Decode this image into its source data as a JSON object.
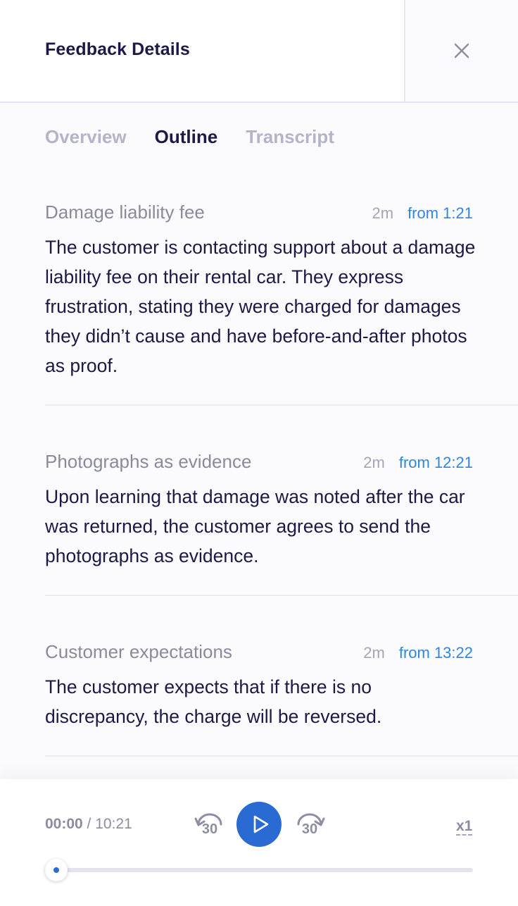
{
  "header": {
    "title": "Feedback Details"
  },
  "tabs": [
    {
      "label": "Overview",
      "active": false
    },
    {
      "label": "Outline",
      "active": true
    },
    {
      "label": "Transcript",
      "active": false
    }
  ],
  "sections": [
    {
      "title": "Damage liability fee",
      "duration": "2m",
      "from": "from 1:21",
      "body": "The customer is contacting support about a damage liability fee on their rental car. They express frustration, stating they were charged for damages they didn’t cause and have before-and-after photos as proof."
    },
    {
      "title": "Photographs as evidence",
      "duration": "2m",
      "from": "from 12:21",
      "body": "Upon learning that damage was noted after the car was returned, the customer agrees to send the photographs as evidence."
    },
    {
      "title": "Customer expectations",
      "duration": "2m",
      "from": "from 13:22",
      "body": "The customer expects that if there is no discrepancy, the charge will be reversed."
    }
  ],
  "player": {
    "current_time": "00:00",
    "separator": " / ",
    "total_time": "10:21",
    "skip_back": "30",
    "skip_forward": "30",
    "speed": "x1",
    "progress": 0.026
  },
  "colors": {
    "accent": "#2a6bd3",
    "link": "#2f86e0",
    "text": "#1d1846",
    "muted": "#8b8a9d"
  },
  "icons": {
    "close": "close-icon",
    "play": "play-icon",
    "rewind": "rewind-30-icon",
    "forward": "forward-30-icon"
  }
}
